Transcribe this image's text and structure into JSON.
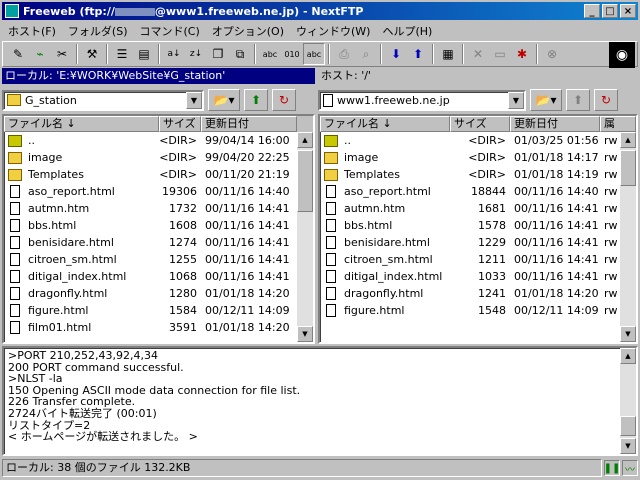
{
  "window": {
    "title_prefix": "Freeweb (ftp://",
    "title_suffix": "@www1.freeweb.ne.jp) - NextFTP",
    "min": "_",
    "max": "□",
    "close": "×"
  },
  "menu": [
    "ホスト(F)",
    "フォルダ(S)",
    "コマンド(C)",
    "オプション(O)",
    "ウィンドウ(W)",
    "ヘルプ(H)"
  ],
  "local": {
    "header": "ローカル: 'E:¥WORK¥WebSite¥G_station'",
    "combo": "G_station",
    "columns": [
      "ファイル名 ↓",
      "サイズ",
      "更新日付"
    ],
    "files": [
      {
        "type": "up",
        "name": "..",
        "size": "<DIR>",
        "date": "99/04/14 16:00"
      },
      {
        "type": "folder",
        "name": "image",
        "size": "<DIR>",
        "date": "99/04/20 22:25"
      },
      {
        "type": "folder",
        "name": "Templates",
        "size": "<DIR>",
        "date": "00/11/20 21:19"
      },
      {
        "type": "file",
        "name": "aso_report.html",
        "size": "19306",
        "date": "00/11/16 14:40"
      },
      {
        "type": "file",
        "name": "autmn.htm",
        "size": "1732",
        "date": "00/11/16 14:41"
      },
      {
        "type": "file",
        "name": "bbs.html",
        "size": "1608",
        "date": "00/11/16 14:41"
      },
      {
        "type": "file",
        "name": "benisidare.html",
        "size": "1274",
        "date": "00/11/16 14:41"
      },
      {
        "type": "file",
        "name": "citroen_sm.html",
        "size": "1255",
        "date": "00/11/16 14:41"
      },
      {
        "type": "file",
        "name": "ditigal_index.html",
        "size": "1068",
        "date": "00/11/16 14:41"
      },
      {
        "type": "file",
        "name": "dragonfly.html",
        "size": "1280",
        "date": "01/01/18 14:20"
      },
      {
        "type": "file",
        "name": "figure.html",
        "size": "1584",
        "date": "00/12/11 14:09"
      },
      {
        "type": "file",
        "name": "film01.html",
        "size": "3591",
        "date": "01/01/18 14:20"
      }
    ]
  },
  "remote": {
    "header": "ホスト: '/'",
    "combo": "www1.freeweb.ne.jp",
    "columns": [
      "ファイル名 ↓",
      "サイズ",
      "更新日付",
      "属"
    ],
    "files": [
      {
        "type": "up",
        "name": "..",
        "size": "<DIR>",
        "date": "01/03/25 01:56",
        "attr": "rw"
      },
      {
        "type": "folder",
        "name": "image",
        "size": "<DIR>",
        "date": "01/01/18 14:17",
        "attr": "rw"
      },
      {
        "type": "folder",
        "name": "Templates",
        "size": "<DIR>",
        "date": "01/01/18 14:19",
        "attr": "rw"
      },
      {
        "type": "file",
        "name": "aso_report.html",
        "size": "18844",
        "date": "00/11/16 14:40",
        "attr": "rw"
      },
      {
        "type": "file",
        "name": "autmn.htm",
        "size": "1681",
        "date": "00/11/16 14:41",
        "attr": "rw"
      },
      {
        "type": "file",
        "name": "bbs.html",
        "size": "1578",
        "date": "00/11/16 14:41",
        "attr": "rw"
      },
      {
        "type": "file",
        "name": "benisidare.html",
        "size": "1229",
        "date": "00/11/16 14:41",
        "attr": "rw"
      },
      {
        "type": "file",
        "name": "citroen_sm.html",
        "size": "1211",
        "date": "00/11/16 14:41",
        "attr": "rw"
      },
      {
        "type": "file",
        "name": "ditigal_index.html",
        "size": "1033",
        "date": "00/11/16 14:41",
        "attr": "rw"
      },
      {
        "type": "file",
        "name": "dragonfly.html",
        "size": "1241",
        "date": "01/01/18 14:20",
        "attr": "rw"
      },
      {
        "type": "file",
        "name": "figure.html",
        "size": "1548",
        "date": "00/12/11 14:09",
        "attr": "rw"
      }
    ]
  },
  "log": [
    ">PORT 210,252,43,92,4,34",
    "200 PORT command successful.",
    ">NLST -la",
    "150 Opening ASCII mode data connection for file list.",
    "226 Transfer complete.",
    "2724バイト転送完了 (00:01)",
    "リストタイプ=2",
    "< ホームページが転送されました。 >"
  ],
  "status": "ローカル: 38 個のファイル  132.2KB"
}
